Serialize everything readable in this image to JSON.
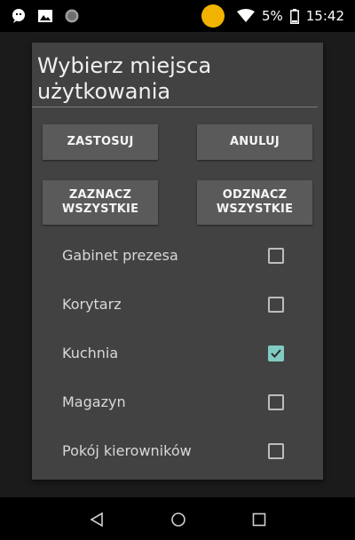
{
  "status_bar": {
    "battery_percent": "5%",
    "time": "15:42"
  },
  "dialog": {
    "title": "Wybierz miejsca użytkowania",
    "buttons": {
      "apply": "ZASTOSUJ",
      "cancel": "ANULUJ",
      "select_all": "ZAZNACZ WSZYSTKIE",
      "deselect_all": "ODZNACZ WSZYSTKIE"
    },
    "items": [
      {
        "label": "Gabinet prezesa",
        "checked": false
      },
      {
        "label": "Korytarz",
        "checked": false
      },
      {
        "label": "Kuchnia",
        "checked": true
      },
      {
        "label": "Magazyn",
        "checked": false
      },
      {
        "label": "Pokój kierowników",
        "checked": false
      }
    ],
    "accent_color": "#80cbc4"
  },
  "icons": {
    "status_left": [
      "message-icon",
      "image-icon",
      "sync-icon"
    ],
    "status_right": [
      "wifi-icon",
      "battery-icon"
    ],
    "nav": [
      "back-icon",
      "home-icon",
      "recent-apps-icon"
    ]
  }
}
